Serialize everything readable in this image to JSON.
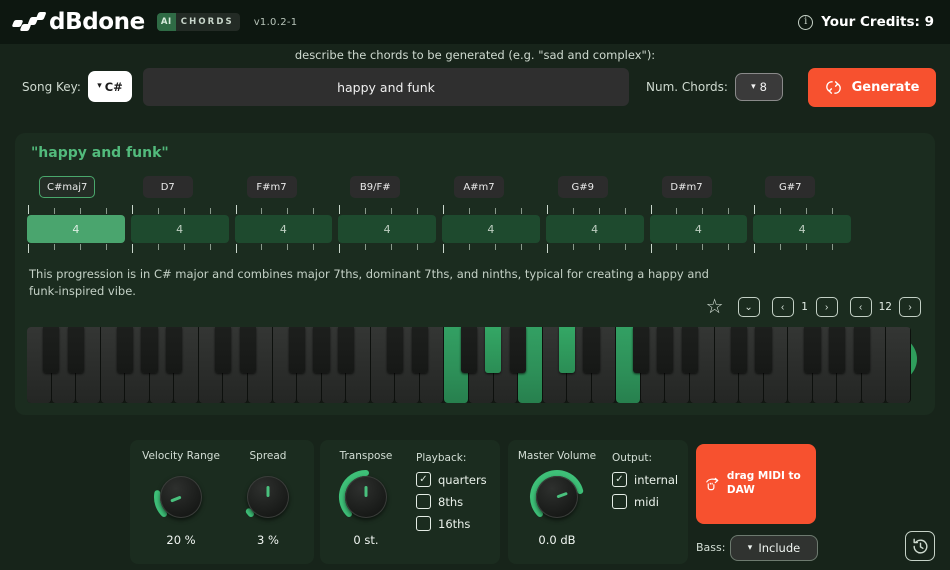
{
  "header": {
    "brand": "dBdone",
    "badge_ai": "AI",
    "badge_chords": "CHORDS",
    "version": "v1.0.2-1",
    "info_icon": "i",
    "credits": "Your Credits: 9"
  },
  "prompt": {
    "instruction": "describe the chords to be generated (e.g. \"sad and complex\"):",
    "song_key_label": "Song Key:",
    "song_key_value": "C#",
    "input_value": "happy and funk",
    "input_placeholder": "describe the chords to be generated",
    "num_chords_label": "Num. Chords:",
    "num_chords_value": "8",
    "generate_label": "Generate",
    "generate_icon": "↻"
  },
  "progression": {
    "title": "\"happy and funk\"",
    "chords": [
      {
        "name": "C#maj7",
        "beats": "4",
        "selected": true
      },
      {
        "name": "D7",
        "beats": "4",
        "selected": false
      },
      {
        "name": "F#m7",
        "beats": "4",
        "selected": false
      },
      {
        "name": "B9/F#",
        "beats": "4",
        "selected": false
      },
      {
        "name": "A#m7",
        "beats": "4",
        "selected": false
      },
      {
        "name": "G#9",
        "beats": "4",
        "selected": false
      },
      {
        "name": "D#m7",
        "beats": "4",
        "selected": false
      },
      {
        "name": "G#7",
        "beats": "4",
        "selected": false
      }
    ],
    "description": "This progression is in C# major and combines major 7ths, dominant 7ths, and ninths, typical for creating a happy and funk-inspired vibe.",
    "play_icon": "play-triangle",
    "star_icon": "☆",
    "dropdown_icon": "⌄",
    "prev_icon": "‹",
    "next_icon": "›",
    "page_current": "1",
    "variation_current": "12"
  },
  "piano": {
    "highlighted_white_keys": [
      17,
      20,
      24
    ],
    "highlighted_black_keys": [
      9,
      16,
      18,
      21
    ]
  },
  "controls": {
    "velocity": {
      "label": "Velocity Range",
      "value": "20 %",
      "angle": -112,
      "arc": 20
    },
    "spread": {
      "label": "Spread",
      "value": "3 %",
      "angle": 0,
      "arc": 3
    },
    "transpose": {
      "label": "Transpose",
      "value": "0 st.",
      "angle": 0,
      "arc": 50
    },
    "master_volume": {
      "label": "Master Volume",
      "value": "0.0 dB",
      "angle": 70,
      "arc": 78
    },
    "playback": {
      "title": "Playback:",
      "options": [
        {
          "label": "quarters",
          "checked": true
        },
        {
          "label": "8ths",
          "checked": false
        },
        {
          "label": "16ths",
          "checked": false
        }
      ]
    },
    "output": {
      "title": "Output:",
      "options": [
        {
          "label": "internal",
          "checked": true
        },
        {
          "label": "midi",
          "checked": false
        }
      ]
    }
  },
  "footer": {
    "drag_midi_label": "drag MIDI to DAW",
    "drag_midi_icon": "drag-hand-icon",
    "bass_label": "Bass:",
    "bass_value": "Include",
    "history_icon": "history-clock-icon"
  },
  "colors": {
    "accent_green": "#2f9e5c",
    "accent_orange": "#f7512f",
    "panel_bg": "#1b2c1f",
    "page_bg": "#17241a"
  }
}
